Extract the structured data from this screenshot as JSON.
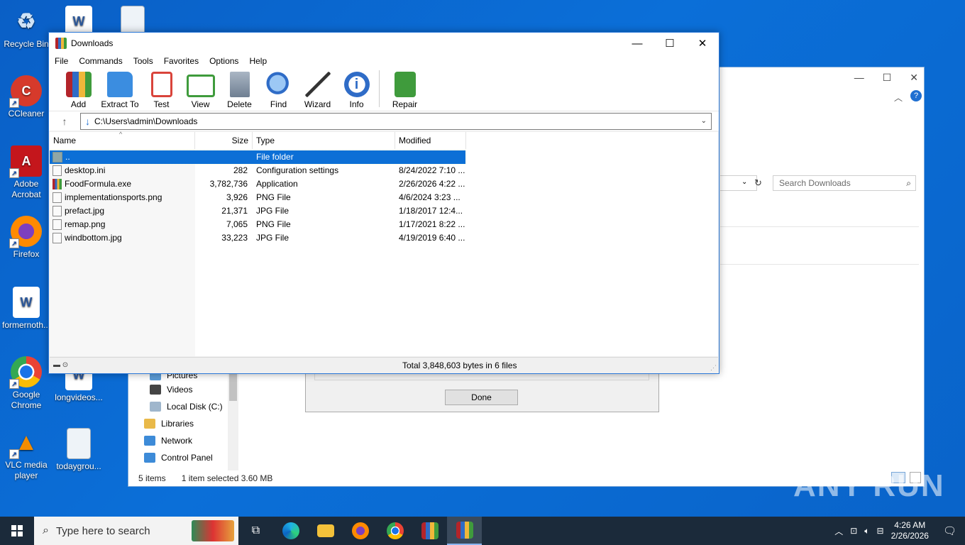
{
  "desktop": {
    "icons": [
      {
        "label": "Recycle Bin",
        "icon": "recycle-bin-icon"
      },
      {
        "label": "CCleaner",
        "icon": "ccleaner-icon"
      },
      {
        "label": "Adobe Acrobat",
        "icon": "acrobat-icon"
      },
      {
        "label": "Firefox",
        "icon": "firefox-icon"
      },
      {
        "label": "formernoth...",
        "icon": "word-doc-icon"
      },
      {
        "label": "Google Chrome",
        "icon": "chrome-icon"
      },
      {
        "label": "VLC media player",
        "icon": "vlc-icon"
      },
      {
        "label": "longvideos...",
        "icon": "word-doc-icon"
      },
      {
        "label": "todaygrou...",
        "icon": "image-file-icon"
      }
    ]
  },
  "explorer": {
    "search_placeholder": "Search Downloads",
    "nav": [
      {
        "label": "Pictures"
      },
      {
        "label": "Videos"
      },
      {
        "label": "Local Disk (C:)"
      },
      {
        "label": "Libraries"
      },
      {
        "label": "Network"
      },
      {
        "label": "Control Panel"
      }
    ],
    "status_items": "5 items",
    "status_selected": "1 item selected  3.60 MB"
  },
  "dialog": {
    "done_label": "Done"
  },
  "winrar": {
    "title": "Downloads",
    "menu": [
      "File",
      "Commands",
      "Tools",
      "Favorites",
      "Options",
      "Help"
    ],
    "toolbar": [
      {
        "label": "Add",
        "icon": "add-archive-icon",
        "color": "#c0392b"
      },
      {
        "label": "Extract To",
        "icon": "extract-folder-icon",
        "color": "#3b8de0"
      },
      {
        "label": "Test",
        "icon": "test-clipboard-icon",
        "color": "#d9443b"
      },
      {
        "label": "View",
        "icon": "view-book-icon",
        "color": "#3f9b3c"
      },
      {
        "label": "Delete",
        "icon": "trash-icon",
        "color": "#8a97a8"
      },
      {
        "label": "Find",
        "icon": "magnifier-icon",
        "color": "#2f6cc7"
      },
      {
        "label": "Wizard",
        "icon": "wizard-wand-icon",
        "color": "#6a6a6a"
      },
      {
        "label": "Info",
        "icon": "info-icon",
        "color": "#2f6cc7"
      },
      {
        "label": "Repair",
        "icon": "repair-kit-icon",
        "color": "#3f9b3c"
      }
    ],
    "path": "C:\\Users\\admin\\Downloads",
    "columns": {
      "name": "Name",
      "size": "Size",
      "type": "Type",
      "modified": "Modified"
    },
    "files": [
      {
        "name": "..",
        "size": "",
        "type": "File folder",
        "modified": "",
        "icon": "folder"
      },
      {
        "name": "desktop.ini",
        "size": "282",
        "type": "Configuration settings",
        "modified": "8/24/2022 7:10 ...",
        "icon": "file"
      },
      {
        "name": "FoodFormula.exe",
        "size": "3,782,736",
        "type": "Application",
        "modified": "2/26/2026 4:22 ...",
        "icon": "exe"
      },
      {
        "name": "implementationsports.png",
        "size": "3,926",
        "type": "PNG File",
        "modified": "4/6/2024 3:23 ...",
        "icon": "file"
      },
      {
        "name": "prefact.jpg",
        "size": "21,371",
        "type": "JPG File",
        "modified": "1/18/2017 12:4...",
        "icon": "file"
      },
      {
        "name": "remap.png",
        "size": "7,065",
        "type": "PNG File",
        "modified": "1/17/2021 8:22 ...",
        "icon": "file"
      },
      {
        "name": "windbottom.jpg",
        "size": "33,223",
        "type": "JPG File",
        "modified": "4/19/2019 6:40 ...",
        "icon": "file"
      }
    ],
    "status": "Total 3,848,603 bytes in 6 files"
  },
  "taskbar": {
    "search_placeholder": "Type here to search",
    "time": "4:26 AM",
    "date": "2/26/2026"
  },
  "watermark": "ANY RUN"
}
